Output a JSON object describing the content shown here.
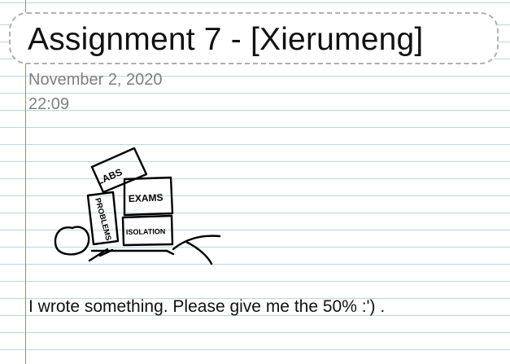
{
  "page": {
    "title": "Assignment 7 - [Xierumeng]",
    "date": "November 2, 2020",
    "time": "22:09",
    "body_text": "I wrote something.  Please  give  me  the  50% :')  ."
  },
  "drawing": {
    "labels": {
      "labs": "LABS",
      "exams": "EXAMS",
      "problems": "PROBLEMS",
      "isolation": "ISOLATION"
    }
  }
}
